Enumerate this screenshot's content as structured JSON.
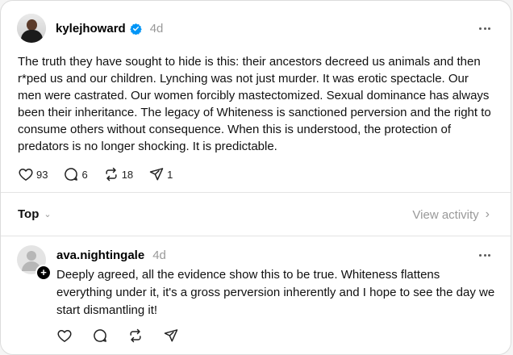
{
  "post": {
    "username": "kylejhoward",
    "time": "4d",
    "text": "The truth they have sought to hide is this: their ancestors decreed us animals and then r*ped us and our children. Lynching was not just murder. It was erotic spectacle. Our men were castrated. Our women forcibly mastectomized. Sexual dominance has always been their inheritance. The legacy of Whiteness is sanctioned perversion and the right to consume others without consequence. When this is understood, the protection of predators is no longer shocking. It is predictable.",
    "likes": "93",
    "comments": "6",
    "reposts": "18",
    "shares": "1",
    "verified_color": "#0095f6"
  },
  "thread": {
    "sort_label": "Top",
    "view_activity": "View activity"
  },
  "reply": {
    "username": "ava.nightingale",
    "time": "4d",
    "text": "Deeply agreed, all the evidence show this to be true. Whiteness flattens everything under it, it's a gross perversion inherently and I hope to see the day we start dismantling it!",
    "follow_glyph": "+"
  },
  "icons": {
    "like": "heart-icon",
    "comment": "comment-icon",
    "repost": "repost-icon",
    "share": "send-icon",
    "more": "more-icon"
  }
}
